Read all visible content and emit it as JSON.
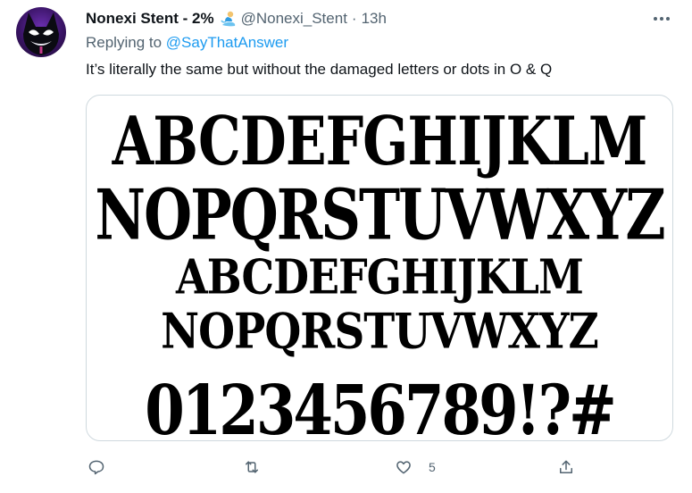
{
  "author": {
    "display_name": "Nonexi Stent - 2%",
    "handle": "@Nonexi_Stent",
    "separator": "·",
    "time": "13h"
  },
  "reply": {
    "prefix": "Replying to",
    "mention": "@SayThatAnswer"
  },
  "tweet": {
    "text": "It’s literally the same but without the damaged letters or dots in O & Q"
  },
  "media": {
    "rows": [
      "ABCDEFGHIJKLM",
      "NOPQRSTUVWXYZ",
      "ABCDEFGHIJKLM",
      "NOPQRSTUVWXYZ",
      "0123456789!?#"
    ]
  },
  "actions": {
    "reply_icon": "comment-icon",
    "retweet_icon": "retweet-icon",
    "like_icon": "heart-icon",
    "like_count": "5",
    "share_icon": "share-icon"
  },
  "colors": {
    "link": "#1d9bf0",
    "secondary_text": "#536471",
    "primary_text": "#0f1419",
    "border": "#cfd9de"
  }
}
